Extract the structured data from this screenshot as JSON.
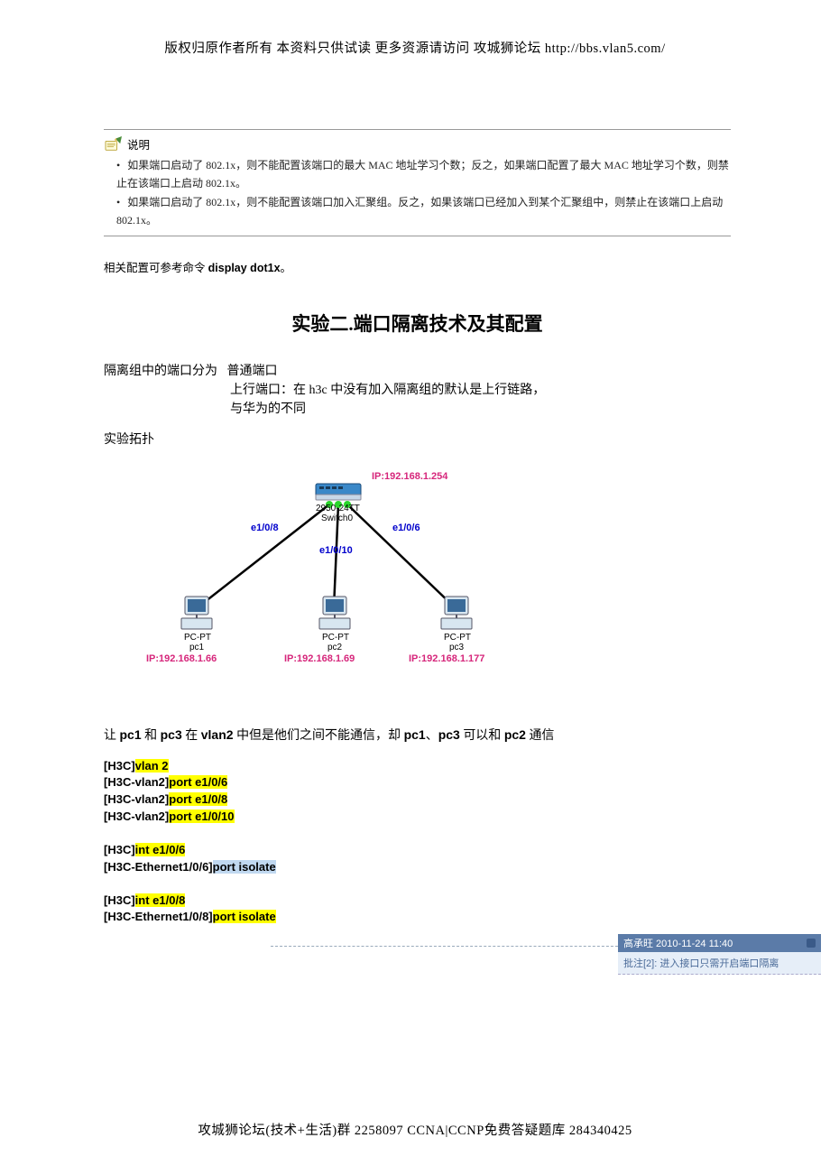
{
  "header": "版权归原作者所有 本资料只供试读 更多资源请访问 攻城狮论坛 http://bbs.vlan5.com/",
  "footer": "攻城狮论坛(技术+生活)群 2258097 CCNA|CCNP免费答疑题库 284340425",
  "note": {
    "label": "说明",
    "items": [
      "如果端口启动了 802.1x，则不能配置该端口的最大 MAC 地址学习个数；反之，如果端口配置了最大 MAC 地址学习个数，则禁止在该端口上启动 802.1x。",
      "如果端口启动了 802.1x，则不能配置该端口加入汇聚组。反之，如果该端口已经加入到某个汇聚组中，则禁止在该端口上启动 802.1x。"
    ]
  },
  "ref_prefix": "相关配置可参考命令 ",
  "ref_cmd": "display dot1x",
  "ref_suffix": "。",
  "title": "实验二.端口隔离技术及其配置",
  "intro": {
    "line1_pre": "隔离组中的端口分为",
    "line1_post": "普通端口",
    "line2": "上行端口：在 h3c 中没有加入隔离组的默认是上行链路，",
    "line3": "与华为的不同"
  },
  "topo_title": "实验拓扑",
  "topo": {
    "switch_ip": "IP:192.168.1.254",
    "switch_model": "2950-24TT",
    "switch_name": "Switch0",
    "e8": "e1/0/8",
    "e10": "e1/0/10",
    "e6": "e1/0/6",
    "pc_pt": "PC-PT",
    "pc1": "pc1",
    "pc2": "pc2",
    "pc3": "pc3",
    "ip1": "IP:192.168.1.66",
    "ip2": "IP:192.168.1.69",
    "ip3": "IP:192.168.1.177"
  },
  "req_pre": "让 ",
  "req_b1": "pc1",
  "req_m1": " 和 ",
  "req_b2": "pc3",
  "req_m2": " 在 ",
  "req_b3": "vlan2",
  "req_m3": " 中但是他们之间不能通信，却 ",
  "req_b4": "pc1",
  "req_m4": "、",
  "req_b5": "pc3",
  "req_m5": " 可以和 ",
  "req_b6": "pc2",
  "req_m6": " 通信",
  "cli": {
    "l1_b": "[H3C]",
    "l1_hl": "vlan 2",
    "l2_b": "[H3C-vlan2]",
    "l2_hl": "port e1/0/6",
    "l3_b": "[H3C-vlan2]",
    "l3_hl": "port e1/0/8",
    "l4_b": "[H3C-vlan2]",
    "l4_hl": "port e1/0/10",
    "l5_b": "[H3C]",
    "l5_hl": "int e1/0/6",
    "l6_b": "[H3C-Ethernet1/0/6]",
    "l6_hl": "port isolate",
    "l7_b": "[H3C]",
    "l7_hl": "int e1/0/8",
    "l8_b": "[H3C-Ethernet1/0/8]",
    "l8_hl": "port isolate"
  },
  "comment": {
    "head": "高承旺 2010-11-24 11:40",
    "body": "批注[2]: 进入接口只需开启端口隔离"
  }
}
